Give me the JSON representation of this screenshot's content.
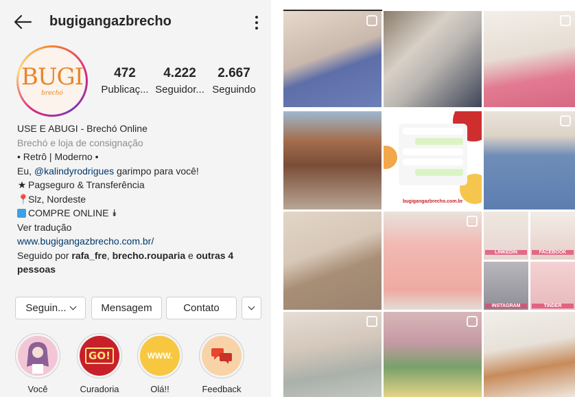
{
  "header": {
    "username": "bugigangazbrecho"
  },
  "avatar": {
    "logo_text": "BUGI",
    "logo_subtext": "brechó"
  },
  "stats": [
    {
      "value": "472",
      "label": "Publicaç..."
    },
    {
      "value": "4.222",
      "label": "Seguidor..."
    },
    {
      "value": "2.667",
      "label": "Seguindo"
    }
  ],
  "bio": {
    "name": "USE E ABUGI - Brechó Online",
    "category": "Brechó e loja de consignação",
    "line1": "• Retrô | Moderno •",
    "line2_prefix": "Eu, ",
    "line2_mention": "@kalindyrodrigues",
    "line2_suffix": " garimpo para você!",
    "line3_icon": "★",
    "line3": "Pagseguro & Transferência",
    "line4_icon": "📍",
    "line4": "Slz, Nordeste",
    "line5": "COMPRE ONLINE",
    "line5_icon": "⯯",
    "translate": "Ver tradução",
    "website": "www.bugigangazbrecho.com.br/",
    "followed_prefix": "Seguido por ",
    "followed_user1": "rafa_fre",
    "followed_sep": ", ",
    "followed_user2": "brecho.rouparia",
    "followed_and": " e ",
    "followed_others_1": "outras 4",
    "followed_others_2": "pessoas"
  },
  "buttons": {
    "following": "Seguin...",
    "message": "Mensagem",
    "contact": "Contato"
  },
  "highlights": [
    {
      "label": "Você"
    },
    {
      "label": "Curadoria",
      "art_text": "GO!"
    },
    {
      "label": "Olá!!",
      "art_text": "WWW."
    },
    {
      "label": "Feedback"
    }
  ],
  "grid": {
    "tile5_url": "bugigangazbrecho.com.br",
    "tile9_tags": [
      "LINKEDIN",
      "FACEBOOK",
      "INSTAGRAM",
      "TINDER"
    ]
  },
  "colors": {
    "link": "#00376b",
    "text": "#262626",
    "muted": "#8e8e8e"
  }
}
